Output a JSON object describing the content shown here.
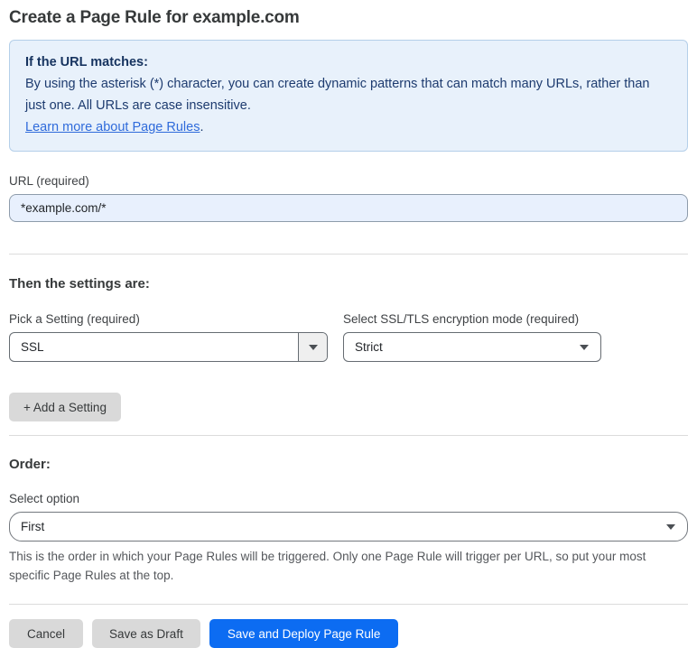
{
  "page": {
    "title": "Create a Page Rule for example.com"
  },
  "info_box": {
    "heading": "If the URL matches:",
    "body": "By using the asterisk (*) character, you can create dynamic patterns that can match many URLs, rather than just one. All URLs are case insensitive.",
    "link_label": "Learn more about Page Rules",
    "link_suffix": "."
  },
  "url_field": {
    "label": "URL (required)",
    "value": "*example.com/*"
  },
  "settings_section": {
    "heading": "Then the settings are:",
    "setting_picker": {
      "label": "Pick a Setting (required)",
      "selected_value": "SSL"
    },
    "ssl_mode_picker": {
      "label": "Select SSL/TLS encryption mode (required)",
      "selected_value": "Strict"
    },
    "add_setting_label": "+ Add a Setting"
  },
  "order_section": {
    "heading": "Order:",
    "select_label": "Select option",
    "selected_value": "First",
    "help_text": "This is the order in which your Page Rules will be triggered. Only one Page Rule will trigger per URL, so put your most specific Page Rules at the top."
  },
  "footer": {
    "cancel_label": "Cancel",
    "save_draft_label": "Save as Draft",
    "save_deploy_label": "Save and Deploy Page Rule"
  },
  "icons": {
    "dropdown_caret": "caret-down-icon"
  },
  "colors": {
    "primary_button": "#0c6cf2",
    "info_background": "#e8f1fb",
    "info_border": "#b4cfe9",
    "info_text": "#1d3b6f",
    "link": "#2f6bdb",
    "input_background": "#e8f0fd"
  }
}
